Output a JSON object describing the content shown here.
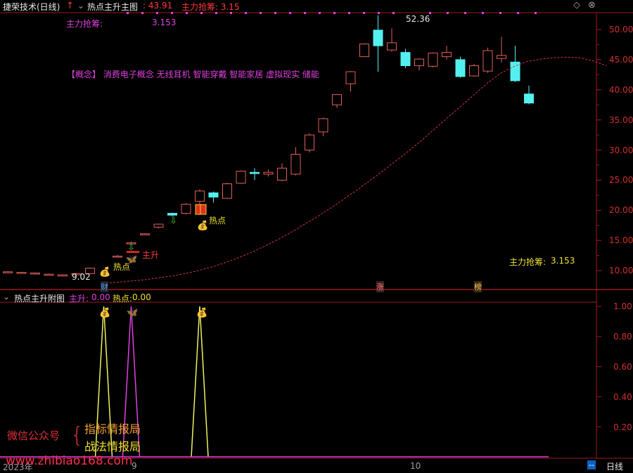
{
  "title_bar": {
    "app_name": "捷荣技术(日线)",
    "indicator_name": "热点主升主图",
    "price_value": ": 43.91",
    "main_label": "主力抢筹: 3.15",
    "diamond_icon": "diamond-icon",
    "close_icon": "close-icon"
  },
  "main_panel": {
    "main_chips_label": "主力抢筹:",
    "main_chips_value": "3.153",
    "concept_text": "【概念】  消费电子概念 无线耳机 智能穿戴 智能家居 虚拟现实 储能",
    "high_label": "52.36",
    "low_label": "9.02",
    "hot_label_1": "热点",
    "hot_label_2": "热点",
    "rise_label": "主升",
    "bottom_right_label": "主力抢筹:",
    "bottom_right_value": "3.153",
    "marker_cai": "财",
    "marker_zhang": "涨",
    "marker_bang": "榜",
    "price_axis": [
      "50.00",
      "45.00",
      "40.00",
      "35.00",
      "30.00",
      "25.00",
      "20.00",
      "15.00",
      "10.00"
    ]
  },
  "sub_panel": {
    "title": "热点主升附图",
    "rise_label": "主升:",
    "rise_value": "0.00",
    "hot_label": "热点:",
    "hot_value": "0.00",
    "axis": [
      "1.00",
      "0.80",
      "0.60",
      "0.40",
      "0.20"
    ]
  },
  "bottom": {
    "date_left": "2023年",
    "date_mid": "9",
    "date_right": "10",
    "period_button": "日线",
    "minus_button": "--"
  },
  "watermark": {
    "left_text": "微信公众号",
    "line1": "指标情报局",
    "line2": "战法情报局",
    "url": "www.zhibiao168.com"
  },
  "chart_data": {
    "type": "candlestick",
    "title": "捷荣技术(日线)",
    "ylim": [
      7.5,
      54
    ],
    "candles": [
      {
        "o": 9.8,
        "c": 9.8,
        "h": 9.9,
        "l": 9.7
      },
      {
        "o": 9.6,
        "c": 9.7,
        "h": 9.8,
        "l": 9.5
      },
      {
        "o": 9.5,
        "c": 9.6,
        "h": 9.7,
        "l": 9.4
      },
      {
        "o": 9.4,
        "c": 9.4,
        "h": 9.5,
        "l": 9.3
      },
      {
        "o": 9.1,
        "c": 9.3,
        "h": 9.4,
        "l": 9.02
      },
      {
        "o": 9.3,
        "c": 9.5,
        "h": 9.6,
        "l": 9.2
      },
      {
        "o": 9.5,
        "c": 10.4,
        "h": 10.5,
        "l": 9.4
      },
      {
        "o": null,
        "c": null,
        "h": null,
        "l": null
      },
      {
        "o": 12.4,
        "c": 12.4,
        "h": 12.6,
        "l": 12.2
      },
      {
        "o": 14.6,
        "c": 14.6,
        "h": 14.8,
        "l": 14.3
      },
      {
        "o": 16.1,
        "c": 16.1,
        "h": 16.2,
        "l": 16.0
      },
      {
        "o": 17.2,
        "c": 17.7,
        "h": 17.8,
        "l": 17.0
      },
      {
        "o": 19.5,
        "c": 19.2,
        "h": 19.6,
        "l": 19.0
      },
      {
        "o": 19.5,
        "c": 21.0,
        "h": 21.2,
        "l": 19.3
      },
      {
        "o": 21.5,
        "c": 23.2,
        "h": 23.5,
        "l": 21.0
      },
      {
        "o": 22.9,
        "c": 22.2,
        "h": 23.1,
        "l": 21.3
      },
      {
        "o": 22.0,
        "c": 24.4,
        "h": 24.6,
        "l": 21.9
      },
      {
        "o": 24.5,
        "c": 26.5,
        "h": 26.6,
        "l": 24.4
      },
      {
        "o": 26.3,
        "c": 26.1,
        "h": 27.0,
        "l": 25.0
      },
      {
        "o": 26.0,
        "c": 26.3,
        "h": 26.8,
        "l": 25.6
      },
      {
        "o": 25.0,
        "c": 27.0,
        "h": 27.8,
        "l": 24.8
      },
      {
        "o": 26.0,
        "c": 29.3,
        "h": 30.5,
        "l": 25.8
      },
      {
        "o": 30.0,
        "c": 32.5,
        "h": 32.8,
        "l": 29.6
      },
      {
        "o": 33.0,
        "c": 35.2,
        "h": 35.4,
        "l": 32.3
      },
      {
        "o": 37.5,
        "c": 39.2,
        "h": 39.3,
        "l": 37.0
      },
      {
        "o": 41.0,
        "c": 43.0,
        "h": 43.1,
        "l": 39.7
      },
      {
        "o": 45.5,
        "c": 47.6,
        "h": 47.7,
        "l": 45.5
      },
      {
        "o": 49.9,
        "c": 47.3,
        "h": 52.36,
        "l": 43.0
      },
      {
        "o": 46.6,
        "c": 47.8,
        "h": 50.2,
        "l": 46.3
      },
      {
        "o": 46.2,
        "c": 44.0,
        "h": 46.8,
        "l": 43.6
      },
      {
        "o": 44.0,
        "c": 45.1,
        "h": 45.2,
        "l": 43.2
      },
      {
        "o": 43.9,
        "c": 46.1,
        "h": 46.2,
        "l": 43.7
      },
      {
        "o": 45.5,
        "c": 46.2,
        "h": 47.3,
        "l": 45.0
      },
      {
        "o": 45.0,
        "c": 42.2,
        "h": 45.5,
        "l": 42.0
      },
      {
        "o": 42.3,
        "c": 44.0,
        "h": 44.3,
        "l": 42.2
      },
      {
        "o": 43.1,
        "c": 46.5,
        "h": 47.0,
        "l": 42.8
      },
      {
        "o": 45.2,
        "c": 45.7,
        "h": 48.8,
        "l": 44.5
      },
      {
        "o": 44.6,
        "c": 41.5,
        "h": 47.3,
        "l": 41.3
      },
      {
        "o": 39.3,
        "c": 37.8,
        "h": 40.7,
        "l": 37.6
      }
    ],
    "ma_series": [
      7.9,
      8.1,
      8.3,
      8.5,
      8.8,
      9.1,
      9.5,
      10.0,
      10.6,
      11.3,
      12.1,
      13.0,
      14.0,
      15.1,
      16.3,
      17.6,
      18.9,
      20.3,
      21.8,
      23.3,
      24.9,
      26.5,
      28.2,
      29.9,
      31.7,
      33.6,
      35.5,
      37.4,
      39.3,
      41.2,
      42.8,
      43.9,
      44.7,
      45.1,
      45.3,
      45.4,
      45.3,
      44.8,
      44.0
    ],
    "sub_series": {
      "hot_spikes": [
        7,
        14
      ],
      "rise_spikes": [
        9
      ]
    }
  }
}
